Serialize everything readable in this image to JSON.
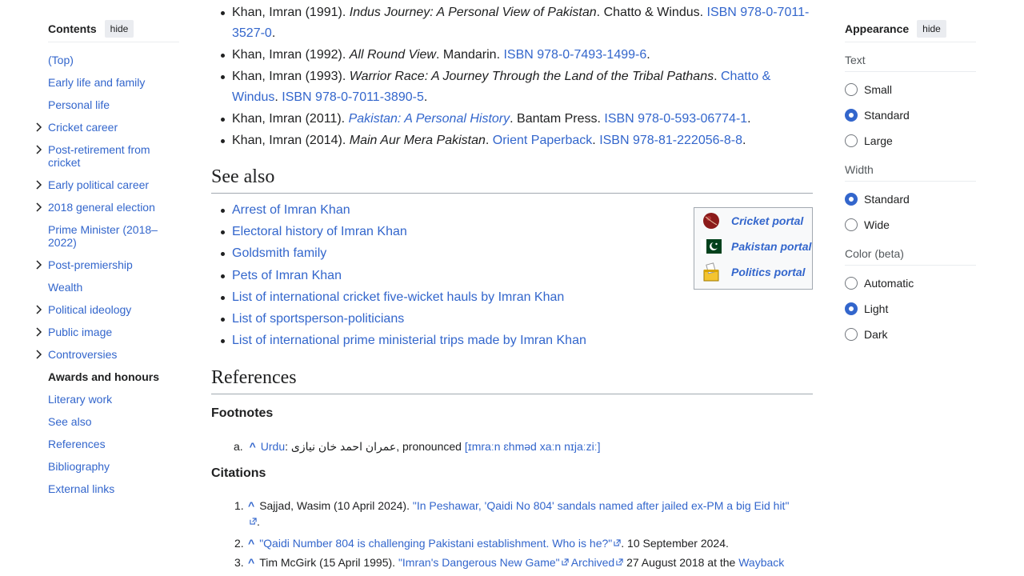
{
  "toc": {
    "title": "Contents",
    "hide_label": "hide",
    "items": [
      {
        "label": "(Top)",
        "expandable": false
      },
      {
        "label": "Early life and family",
        "expandable": false
      },
      {
        "label": "Personal life",
        "expandable": false
      },
      {
        "label": "Cricket career",
        "expandable": true
      },
      {
        "label": "Post-retirement from cricket",
        "expandable": true
      },
      {
        "label": "Early political career",
        "expandable": true
      },
      {
        "label": "2018 general election",
        "expandable": true
      },
      {
        "label": "Prime Minister (2018–2022)",
        "expandable": false
      },
      {
        "label": "Post-premiership",
        "expandable": true
      },
      {
        "label": "Wealth",
        "expandable": false
      },
      {
        "label": "Political ideology",
        "expandable": true
      },
      {
        "label": "Public image",
        "expandable": true
      },
      {
        "label": "Controversies",
        "expandable": true
      },
      {
        "label": "Awards and honours",
        "expandable": false,
        "active": true
      },
      {
        "label": "Literary work",
        "expandable": false
      },
      {
        "label": "See also",
        "expandable": false
      },
      {
        "label": "References",
        "expandable": false
      },
      {
        "label": "Bibliography",
        "expandable": false
      },
      {
        "label": "External links",
        "expandable": false
      }
    ]
  },
  "bibliography": [
    {
      "author": "Khan, Imran (1991). ",
      "title": "Indus Journey: A Personal View of Pakistan",
      "after": ". Chatto & Windus. ",
      "isbn": "ISBN 978-0-7011-3527-0",
      "end": "."
    },
    {
      "author": "Khan, Imran (1992). ",
      "title": "All Round View",
      "after": ". Mandarin. ",
      "isbn": "ISBN 978-0-7493-1499-6",
      "end": "."
    },
    {
      "author": "Khan, Imran (1993). ",
      "title": "Warrior Race: A Journey Through the Land of the Tribal Pathans",
      "after": ". ",
      "publisher_link": "Chatto & Windus",
      "after2": ". ",
      "isbn": "ISBN 978-0-7011-3890-5",
      "end": "."
    },
    {
      "author": "Khan, Imran (2011). ",
      "title_link": "Pakistan: A Personal History",
      "after": ". Bantam Press. ",
      "isbn": "ISBN 978-0-593-06774-1",
      "end": "."
    },
    {
      "author": "Khan, Imran (2014). ",
      "title": "Main Aur Mera Pakistan",
      "after": ". ",
      "publisher_link": "Orient Paperback",
      "after2": ". ",
      "isbn": "ISBN 978-81-222056-8-8",
      "end": "."
    }
  ],
  "see_also": {
    "heading": "See also",
    "links": [
      "Arrest of Imran Khan",
      "Electoral history of Imran Khan",
      "Goldsmith family",
      "Pets of Imran Khan",
      "List of international cricket five-wicket hauls by Imran Khan",
      "List of sportsperson-politicians",
      "List of international prime ministerial trips made by Imran Khan"
    ]
  },
  "portals": [
    {
      "label": "Cricket portal",
      "icon": "cricket-ball-icon"
    },
    {
      "label": "Pakistan portal",
      "icon": "pakistan-flag-icon"
    },
    {
      "label": "Politics portal",
      "icon": "ballot-box-icon"
    }
  ],
  "references": {
    "heading": "References",
    "footnotes_heading": "Footnotes",
    "footnote": {
      "marker": "a.",
      "caret": "^",
      "lang": "Urdu",
      "colon": ": ",
      "urdu": "عمران احمد خان نیازی",
      "pronounced": ", pronounced ",
      "ipa": "[ɪmraːn ɛhməd xaːn nɪjaːziː]"
    },
    "citations_heading": "Citations",
    "citations": [
      {
        "num": "1.",
        "caret": "^",
        "pre": "Sajjad, Wasim (10 April 2024). ",
        "link": "\"In Peshawar, 'Qaidi No 804' sandals named after jailed ex-PM a big Eid hit\"",
        "post": "."
      },
      {
        "num": "2.",
        "caret": "^",
        "pre": "",
        "link": "\"Qaidi Number 804 is challenging Pakistani establishment. Who is he?\"",
        "post": ". 10 September 2024."
      },
      {
        "num": "3.",
        "caret": "^",
        "pre": "Tim McGirk (15 April 1995). ",
        "link": "\"Imran's Dangerous New Game\"",
        "mid": " ",
        "link2": "Archived",
        "post": " 27 August 2018 at the ",
        "link3": "Wayback"
      }
    ]
  },
  "appearance": {
    "title": "Appearance",
    "hide_label": "hide",
    "text": {
      "label": "Text",
      "options": [
        "Small",
        "Standard",
        "Large"
      ],
      "selected": "Standard"
    },
    "width": {
      "label": "Width",
      "options": [
        "Standard",
        "Wide"
      ],
      "selected": "Standard"
    },
    "color": {
      "label": "Color (beta)",
      "options": [
        "Automatic",
        "Light",
        "Dark"
      ],
      "selected": "Light"
    }
  }
}
